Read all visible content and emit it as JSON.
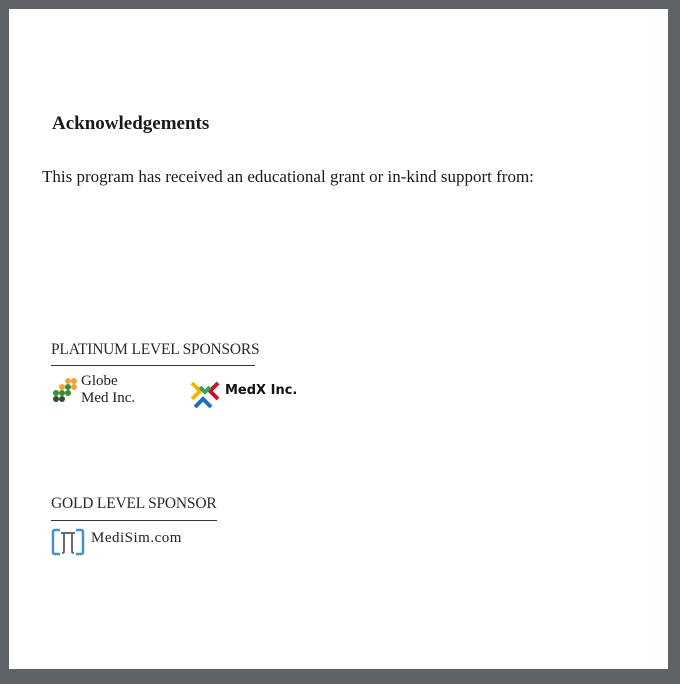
{
  "heading": "Acknowledgements",
  "intro": "This program has received an educational grant or in-kind  support from:",
  "platinum": {
    "title": "PLATINUM LEVEL SPONSORS",
    "sponsors": [
      {
        "name_line1": "Globe",
        "name_line2": "Med Inc.",
        "icon": "globe-med-dots-icon"
      },
      {
        "name": "MedX Inc.",
        "icon": "medx-chevrons-icon"
      }
    ]
  },
  "gold": {
    "title": "GOLD LEVEL SPONSOR",
    "sponsors": [
      {
        "name": "MediSim.com",
        "icon": "medisim-brackets-icon"
      }
    ]
  },
  "colors": {
    "frame": "#5f6266",
    "page": "#ffffff",
    "globe_orange": "#f2a33a",
    "globe_green": "#3d8b37",
    "globe_dark": "#2f4f2f",
    "medx_red": "#c8102e",
    "medx_green": "#3aa655",
    "medx_blue": "#1f6fb8",
    "medx_yellow": "#f2b705",
    "medisim_blue": "#4a90c8",
    "medisim_gray": "#6b6b6b"
  }
}
